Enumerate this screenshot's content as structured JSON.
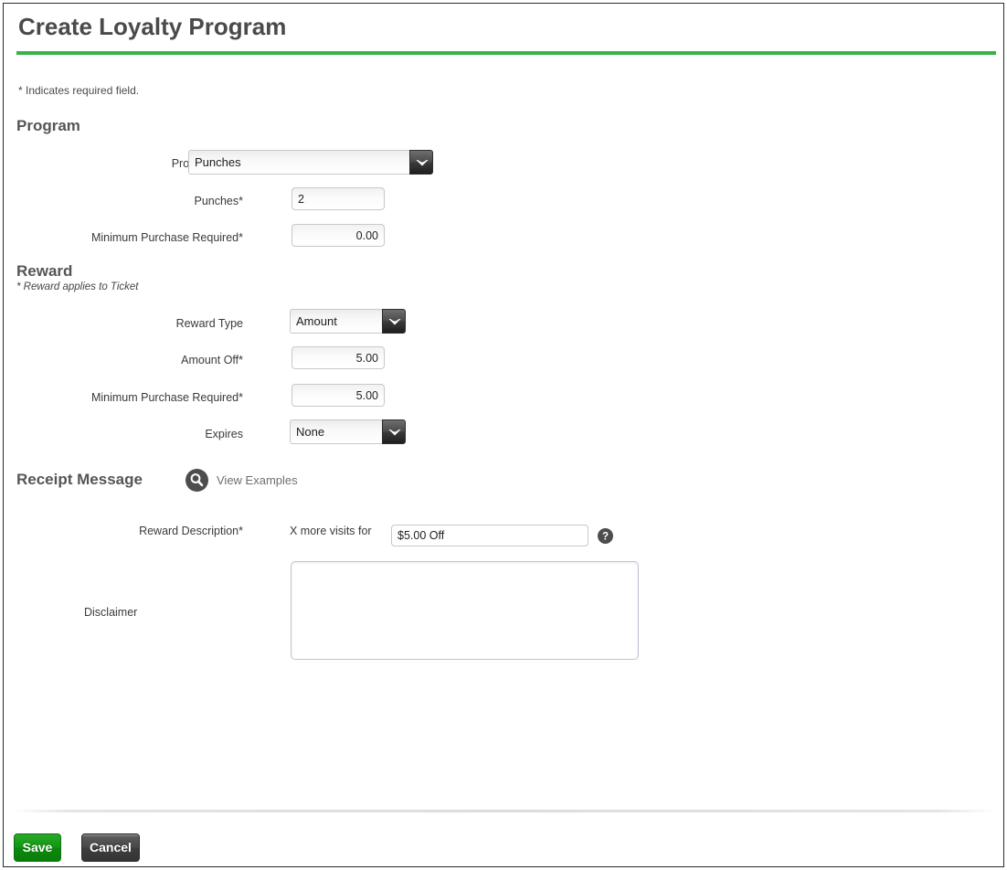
{
  "header": {
    "title": "Create Loyalty Program",
    "accent_color": "#37b34a",
    "required_note": "* Indicates required field."
  },
  "program_section": {
    "heading": "Program",
    "fields": {
      "program_type": {
        "label": "Program Type",
        "value": "Punches",
        "icon": "chevron-down-icon"
      },
      "punches": {
        "label": "Punches*",
        "value": "2"
      },
      "minimum_purchase": {
        "label": "Minimum Purchase Required*",
        "value": "0.00"
      }
    }
  },
  "reward_section": {
    "heading": "Reward",
    "subnote": "* Reward applies to Ticket",
    "fields": {
      "reward_type": {
        "label": "Reward Type",
        "value": "Amount",
        "icon": "chevron-down-icon"
      },
      "amount_off": {
        "label": "Amount Off*",
        "value": "5.00"
      },
      "minimum_purchase": {
        "label": "Minimum Purchase Required*",
        "value": "5.00"
      },
      "expires": {
        "label": "Expires",
        "value": "None",
        "icon": "chevron-down-icon"
      }
    }
  },
  "receipt_section": {
    "heading": "Receipt Message",
    "view_examples": {
      "label": "View Examples",
      "icon": "magnifier-icon"
    },
    "fields": {
      "reward_description": {
        "label": "Reward Description*",
        "prefix_text": "X more visits for",
        "value": "$5.00 Off",
        "help_icon": "help-question-icon"
      },
      "disclaimer": {
        "label": "Disclaimer",
        "value": "",
        "placeholder": ""
      }
    }
  },
  "footer": {
    "save_label": "Save",
    "cancel_label": "Cancel",
    "save_color": "#109810",
    "cancel_color": "#474747"
  }
}
